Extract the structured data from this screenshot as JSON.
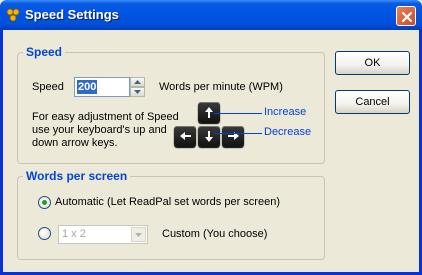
{
  "window": {
    "title": "Speed Settings",
    "icon": "readpal-app-icon",
    "close_icon": "close-icon"
  },
  "speed_group": {
    "legend": "Speed",
    "speed_label": "Speed",
    "speed_value": "200",
    "wpm_label": "Words per minute (WPM)",
    "help_text": "For easy adjustment of Speed use your keyboard's up and down arrow keys.",
    "increase_label": "Increase",
    "decrease_label": "Decrease"
  },
  "words_group": {
    "legend": "Words per screen",
    "automatic_label": "Automatic (Let ReadPal set words per screen)",
    "automatic_selected": true,
    "custom_value": "1 x 2",
    "custom_label": "Custom (You choose)",
    "custom_selected": false
  },
  "buttons": {
    "ok": "OK",
    "cancel": "Cancel"
  },
  "colors": {
    "titlebar": "#0054E3",
    "accent": "#0046D5",
    "face": "#ECE9D8",
    "selection": "#316AC5",
    "close": "#CC4A25"
  }
}
